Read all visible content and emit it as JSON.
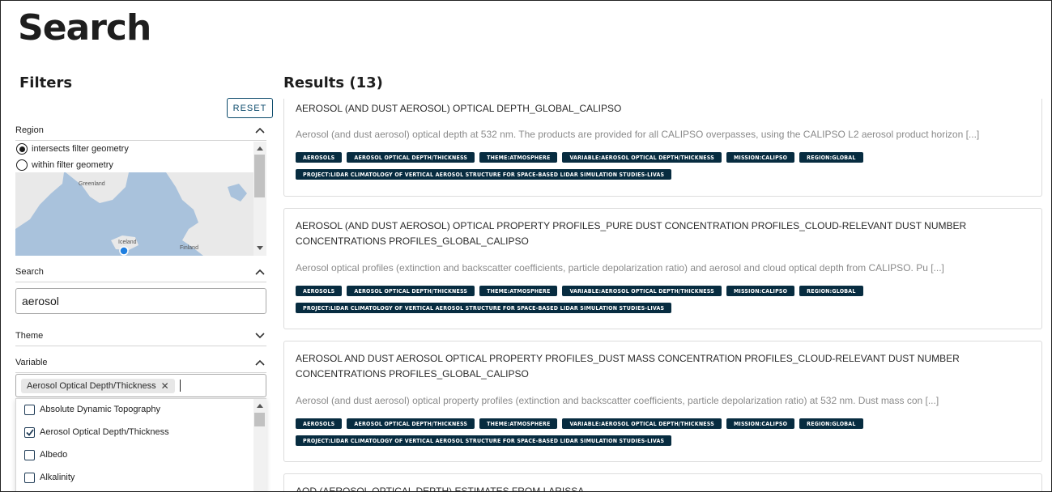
{
  "page": {
    "title": "Search"
  },
  "filters": {
    "title": "Filters",
    "reset_label": "RESET",
    "region": {
      "label": "Region",
      "options": [
        "intersects filter geometry",
        "within filter geometry"
      ],
      "selected": "intersects filter geometry",
      "map_labels": [
        "Greenland",
        "Iceland",
        "Finland"
      ]
    },
    "search": {
      "label": "Search",
      "value": "aerosol"
    },
    "theme": {
      "label": "Theme"
    },
    "variable": {
      "label": "Variable",
      "selected_chip": "Aerosol Optical Depth/Thickness",
      "options": [
        {
          "label": "Absolute Dynamic Topography",
          "checked": false
        },
        {
          "label": "Aerosol Optical Depth/Thickness",
          "checked": true
        },
        {
          "label": "Albedo",
          "checked": false
        },
        {
          "label": "Alkalinity",
          "checked": false
        }
      ]
    }
  },
  "results": {
    "title": "Results (13)",
    "items": [
      {
        "title": "AEROSOL (AND DUST AEROSOL) OPTICAL DEPTH_GLOBAL_CALIPSO",
        "description": "Aerosol (and dust aerosol) optical depth at 532 nm. The products are provided for all CALIPSO overpasses, using the CALIPSO L2 aerosol product horizon [...]",
        "tags": [
          "AEROSOLS",
          "AEROSOL OPTICAL DEPTH/THICKNESS",
          "THEME:ATMOSPHERE",
          "VARIABLE:AEROSOL OPTICAL DEPTH/THICKNESS",
          "MISSION:CALIPSO",
          "REGION:GLOBAL"
        ],
        "tags2": [
          "PROJECT:LIDAR CLIMATOLOGY OF VERTICAL AEROSOL STRUCTURE FOR SPACE-BASED LIDAR SIMULATION STUDIES-LIVAS"
        ]
      },
      {
        "title": "AEROSOL (AND DUST AEROSOL) OPTICAL PROPERTY PROFILES_PURE DUST CONCENTRATION PROFILES_CLOUD-RELEVANT DUST NUMBER CONCENTRATIONS PROFILES_GLOBAL_CALIPSO",
        "description": "Aerosol optical profiles (extinction and backscatter coefficients, particle depolarization ratio) and aerosol and cloud optical depth from CALIPSO. Pu [...]",
        "tags": [
          "AEROSOLS",
          "AEROSOL OPTICAL DEPTH/THICKNESS",
          "THEME:ATMOSPHERE",
          "VARIABLE:AEROSOL OPTICAL DEPTH/THICKNESS",
          "MISSION:CALIPSO",
          "REGION:GLOBAL"
        ],
        "tags2": [
          "PROJECT:LIDAR CLIMATOLOGY OF VERTICAL AEROSOL STRUCTURE FOR SPACE-BASED LIDAR SIMULATION STUDIES-LIVAS"
        ]
      },
      {
        "title": "AEROSOL AND DUST AEROSOL OPTICAL PROPERTY PROFILES_DUST MASS CONCENTRATION PROFILES_CLOUD-RELEVANT DUST NUMBER CONCENTRATIONS PROFILES_GLOBAL_CALIPSO",
        "description": "Aerosol (and dust aerosol) optical property profiles (extinction and backscatter coefficients, particle depolarization ratio) at 532 nm. Dust mass con [...]",
        "tags": [
          "AEROSOLS",
          "AEROSOL OPTICAL DEPTH/THICKNESS",
          "THEME:ATMOSPHERE",
          "VARIABLE:AEROSOL OPTICAL DEPTH/THICKNESS",
          "MISSION:CALIPSO",
          "REGION:GLOBAL"
        ],
        "tags2": [
          "PROJECT:LIDAR CLIMATOLOGY OF VERTICAL AEROSOL STRUCTURE FOR SPACE-BASED LIDAR SIMULATION STUDIES-LIVAS"
        ]
      },
      {
        "title": "AOD (AEROSOL OPTICAL DEPTH) ESTIMATES FROM LARISSA"
      }
    ]
  },
  "colors": {
    "tag_bg": "#072c40",
    "accent": "#0b4a6b",
    "map_water": "#a9c2dc",
    "map_land": "#e9e9e9"
  }
}
